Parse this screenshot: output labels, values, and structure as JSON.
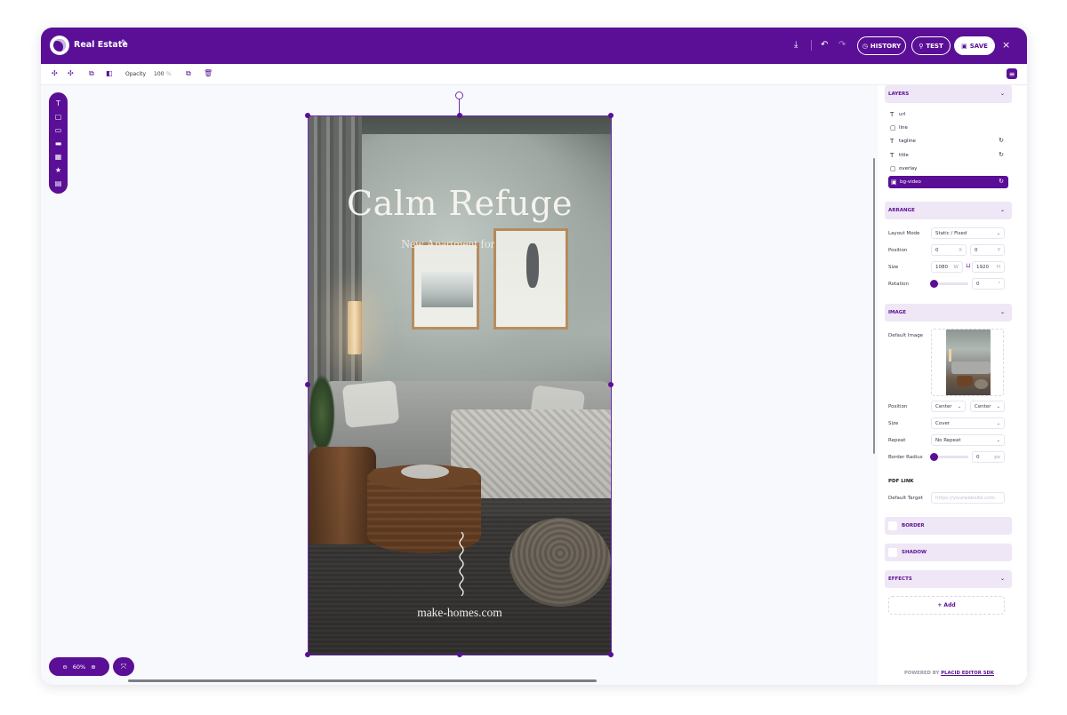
{
  "app": {
    "title": "Real Estate"
  },
  "header": {
    "history_label": "HISTORY",
    "test_label": "TEST",
    "save_label": "SAVE",
    "close_label": "×"
  },
  "toolbar": {
    "opacity_label": "Opacity",
    "opacity_value": "100",
    "opacity_unit": "%"
  },
  "canvas": {
    "title": "Calm Refuge",
    "tagline": "New Apartment for Sale",
    "url": "make-homes.com"
  },
  "zoom": {
    "value": "60%"
  },
  "panel": {
    "layers": {
      "header": "LAYERS",
      "items": [
        {
          "label": "url",
          "icon": "text-icon",
          "sync": false,
          "selected": false
        },
        {
          "label": "line",
          "icon": "square-icon",
          "sync": false,
          "selected": false
        },
        {
          "label": "tagline",
          "icon": "text-icon",
          "sync": true,
          "selected": false
        },
        {
          "label": "title",
          "icon": "text-icon",
          "sync": true,
          "selected": false
        },
        {
          "label": "overlay",
          "icon": "square-icon",
          "sync": false,
          "selected": false
        },
        {
          "label": "bg-video",
          "icon": "image-icon",
          "sync": true,
          "selected": true
        }
      ]
    },
    "arrange": {
      "header": "ARRANGE",
      "layout_mode_label": "Layout Mode",
      "layout_mode_value": "Static / Fixed",
      "position_label": "Position",
      "pos_x": "0",
      "pos_x_unit": "X",
      "pos_y": "0",
      "pos_y_unit": "Y",
      "size_label": "Size",
      "width": "1080",
      "width_unit": "W",
      "height": "1920",
      "height_unit": "H",
      "rotation_label": "Rotation",
      "rotation_value": "0",
      "rotation_unit": "°"
    },
    "image": {
      "header": "IMAGE",
      "default_image_label": "Default Image",
      "position_label": "Position",
      "position_h": "Center",
      "position_v": "Center",
      "size_label": "Size",
      "size_value": "Cover",
      "repeat_label": "Repeat",
      "repeat_value": "No Repeat",
      "border_radius_label": "Border Radius",
      "border_radius_value": "0",
      "border_radius_unit": "px"
    },
    "pdf_link": {
      "header": "PDF LINK",
      "default_target_label": "Default Target",
      "placeholder": "https://yourwebsite.com"
    },
    "border_header": "BORDER",
    "shadow_header": "SHADOW",
    "effects_header": "EFFECTS",
    "add_label": "+ Add",
    "powered_prefix": "POWERED BY",
    "powered_link": "PLACID EDITOR SDK"
  },
  "colors": {
    "accent": "#5a0f96",
    "panel_section_bg": "#efe7f6"
  }
}
